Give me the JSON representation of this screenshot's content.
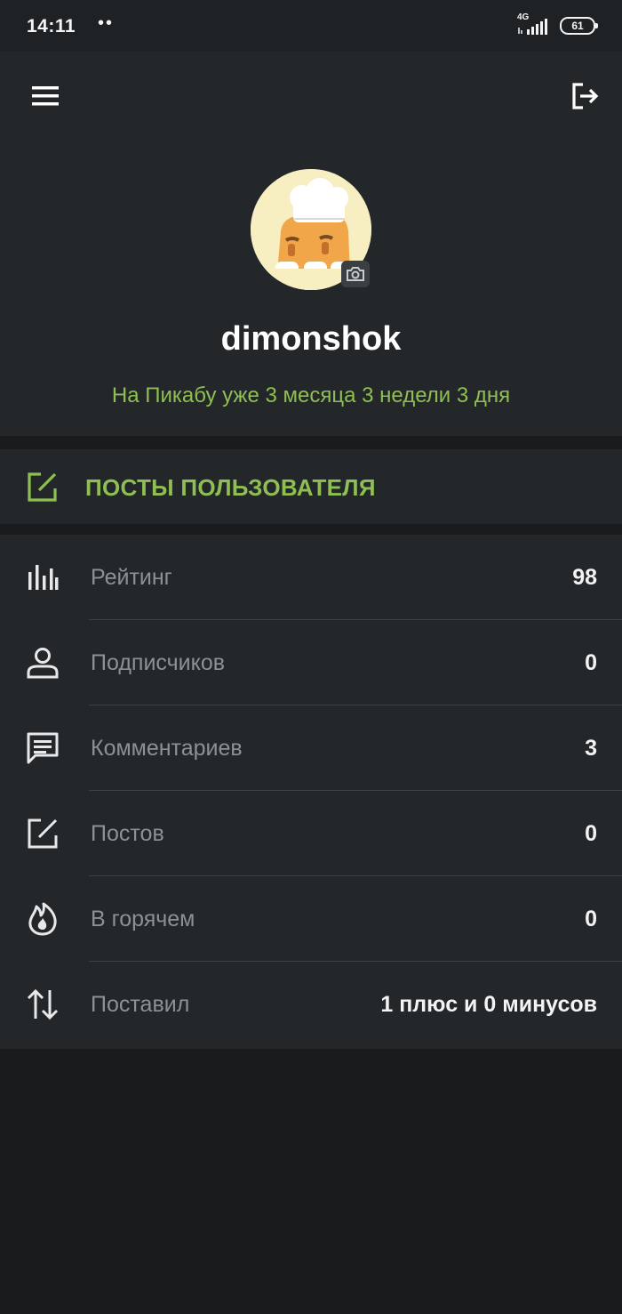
{
  "status": {
    "time": "14:11",
    "dots": "••",
    "network": "4G",
    "battery": "61"
  },
  "profile": {
    "username": "dimonshok",
    "member_since": "На Пикабу уже 3 месяца 3 недели 3 дня"
  },
  "posts_link": {
    "label": "ПОСТЫ ПОЛЬЗОВАТЕЛЯ"
  },
  "stats": {
    "rating": {
      "label": "Рейтинг",
      "value": "98",
      "icon": "bar-chart-icon"
    },
    "subscribers": {
      "label": "Подписчиков",
      "value": "0",
      "icon": "person-icon"
    },
    "comments": {
      "label": "Комментариев",
      "value": "3",
      "icon": "comment-icon"
    },
    "posts": {
      "label": "Постов",
      "value": "0",
      "icon": "edit-icon"
    },
    "hot": {
      "label": "В горячем",
      "value": "0",
      "icon": "flame-icon"
    },
    "votes": {
      "label": "Поставил",
      "value": "1 плюс и 0 минусов",
      "icon": "sort-arrows-icon"
    }
  },
  "colors": {
    "accent_green": "#8fbf52",
    "panel": "#23272a",
    "background": "#1a1b1c"
  }
}
